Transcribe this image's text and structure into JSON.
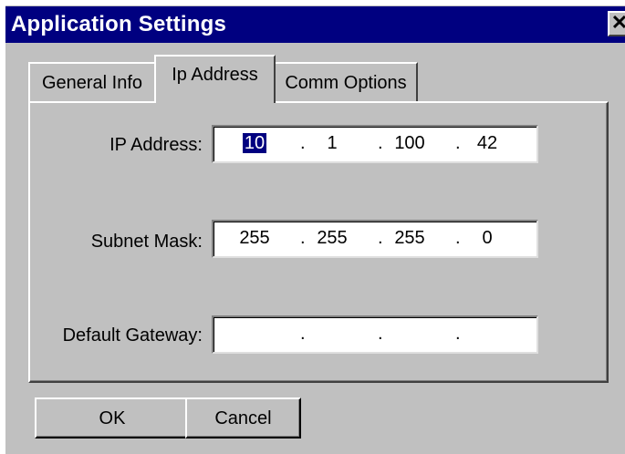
{
  "window": {
    "title": "Application Settings",
    "close_glyph": "✕"
  },
  "tabs": [
    {
      "label": "General Info",
      "active": false
    },
    {
      "label": "Ip Address",
      "active": true
    },
    {
      "label": "Comm Options",
      "active": false
    }
  ],
  "fields": {
    "ip_address": {
      "label": "IP Address:",
      "octets": [
        "10",
        "1",
        "100",
        "42"
      ],
      "selected_octet": 0
    },
    "subnet_mask": {
      "label": "Subnet Mask:",
      "octets": [
        "255",
        "255",
        "255",
        "0"
      ]
    },
    "default_gateway": {
      "label": "Default Gateway:",
      "octets": [
        "",
        "",
        "",
        ""
      ]
    }
  },
  "separator": ".",
  "buttons": {
    "ok": "OK",
    "cancel": "Cancel"
  },
  "colors": {
    "titlebar": "#000080",
    "face": "#c0c0c0",
    "selection": "#000080"
  }
}
